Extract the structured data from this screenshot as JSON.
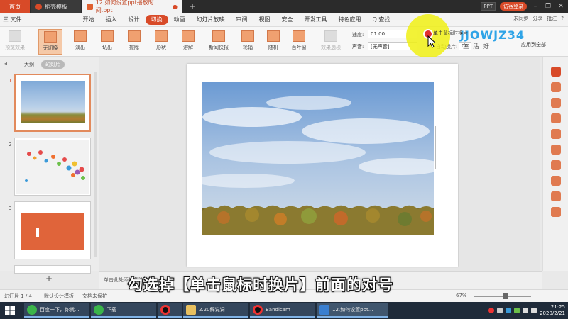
{
  "tabs": {
    "home": "首页",
    "template": "稻壳模板",
    "file": "12.如何设置ppt播放时间.ppt",
    "add": "+"
  },
  "titlebar": {
    "ppt_chip": "PPT",
    "login": "访客登录"
  },
  "menu": {
    "file": "三 文件",
    "items": [
      "开始",
      "插入",
      "设计",
      "切换",
      "动画",
      "幻灯片放映",
      "审阅",
      "视图",
      "安全",
      "开发工具",
      "特色应用"
    ],
    "search": "Q 查找",
    "sync": "未同步",
    "share": "分享",
    "comment": "批注"
  },
  "ribbon": {
    "preview": "预览效果",
    "buttons": [
      "无切换",
      "淡出",
      "切出",
      "擦除",
      "形状",
      "溶解",
      "新闻快报",
      "轮辐",
      "随机",
      "百叶窗"
    ],
    "effect_options": "效果选项",
    "speed_label": "速度:",
    "speed_value": "01.00",
    "sound_label": "声音:",
    "sound_value": "[无声音]",
    "click_label": "单击鼠标时换片",
    "auto_label": "自动换片:",
    "auto_value": "00",
    "apply_all": "应用到全部"
  },
  "watermark": {
    "logo": "JJOWJZ34",
    "sub": "生活好",
    "sub2": "应用到全部"
  },
  "left_panel": {
    "tab_outline": "大纲",
    "tab_slides": "幻灯片",
    "slide_numbers": [
      "1",
      "2",
      "3"
    ],
    "add": "+"
  },
  "notes": {
    "label": "单击此处添加备注"
  },
  "status": {
    "slide_count": "幻灯片 1 / 4",
    "theme": "默认设计模板",
    "doc_protect": "文档未保护",
    "zoom": "67%",
    "zoom_level": 0.55
  },
  "subtitle": "勾选掉【单击鼠标时换片】前面的对号",
  "taskbar": {
    "apps": [
      "百度一下，你就...",
      "下载",
      "",
      "2.20解说词",
      "Bandicam",
      "12.如何设置ppt..."
    ],
    "time": "2020/2/21",
    "time_top": "21:25"
  },
  "colors": {
    "accent": "#d84a28",
    "highlight": "#f0f014",
    "subtitle_text": "#ffffff"
  }
}
